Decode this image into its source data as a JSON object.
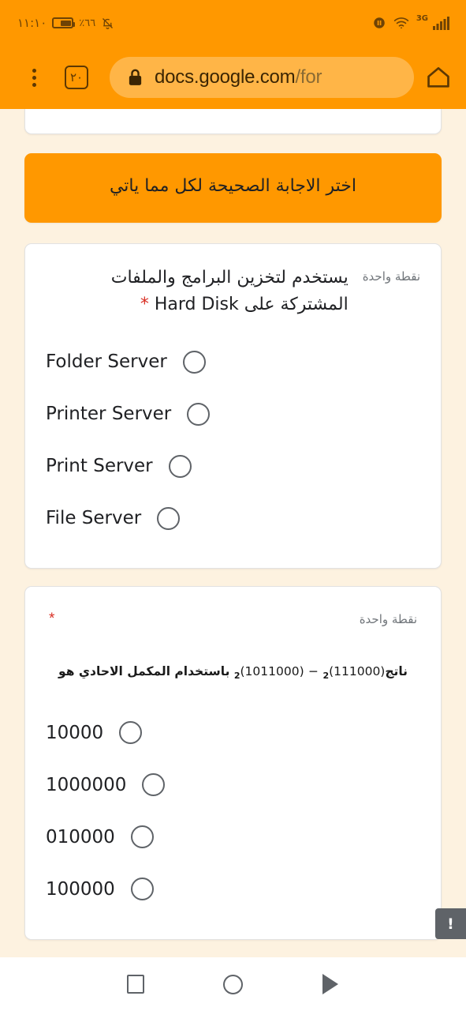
{
  "status_bar": {
    "time": "١١:١٠",
    "battery_percent": "٪٦٦",
    "battery_level": 66,
    "network_label": "3G",
    "icons": [
      "battery-icon",
      "mute-bell-icon",
      "vibrate-icon",
      "wifi-icon",
      "signal-bars-icon"
    ]
  },
  "browser": {
    "tab_count": "٢٠",
    "url_domain": "docs.google.com",
    "url_path": "/for",
    "lock_icon": "lock-icon",
    "menu_icon": "overflow-menu-icon",
    "home_icon": "home-icon"
  },
  "form": {
    "section_title": "اختر الاجابة الصحيحة لكل مما ياتي",
    "questions": [
      {
        "text_line1": "يستخدم لتخزين البرامج والملفات",
        "text_line2_ar_prefix": "المشتركة على",
        "text_line2_latin": "Hard Disk",
        "required_marker": "*",
        "points": "نقطة واحدة",
        "options": [
          "Folder Server",
          "Printer Server",
          "Print Server",
          "File Server"
        ],
        "selected": null
      },
      {
        "points": "نقطة واحدة",
        "required_marker": "*",
        "math_prefix": "ناتج",
        "math_expr_a": "(111000)",
        "math_sub_a": "2",
        "math_minus": "−",
        "math_expr_b": "(1011000)",
        "math_sub_b": "2",
        "math_suffix": "باستخدام المكمل الاحادي هو",
        "options": [
          "10000",
          "1000000",
          "010000",
          "100000"
        ],
        "selected": null
      }
    ]
  },
  "warning_badge": {
    "label": "!"
  },
  "nav_bar": {
    "recents_label": "recents",
    "home_label": "home",
    "back_label": "back"
  },
  "colors": {
    "accent_orange": "#FF9800",
    "page_background": "#FDF2E0",
    "card_white": "#FFFFFF",
    "required_red": "#D93025",
    "muted_text": "#70757A"
  }
}
